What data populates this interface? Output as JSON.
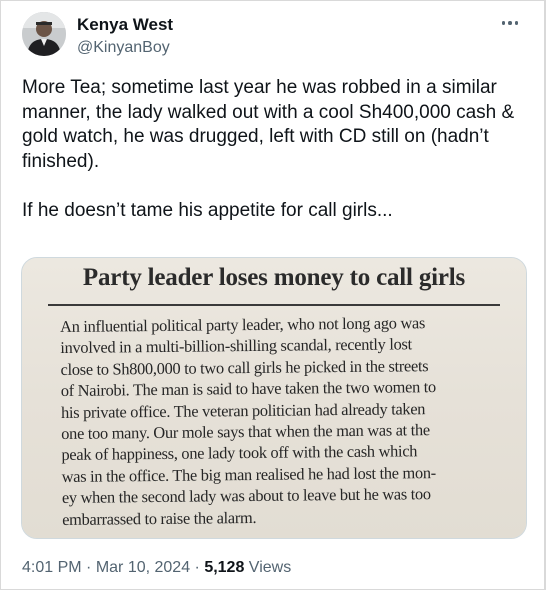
{
  "author": {
    "name": "Kenya West",
    "handle": "@KinyanBoy"
  },
  "tweet": {
    "text": "More Tea; sometime last year he was robbed in a similar manner, the lady walked out with a cool Sh400,000 cash & gold watch, he was drugged, left with CD still on (hadn’t finished).\n\nIf he doesn’t tame his appetite for call girls..."
  },
  "clipping": {
    "headline": "Party leader loses money to call girls",
    "lines": [
      "An influential political party leader, who not long ago was",
      "involved in a multi-billion-shilling scandal, recently lost",
      "close to Sh800,000 to two call girls he picked in the streets",
      "of Nairobi. The man is said to have taken the two women to",
      "his private office. The veteran politician had already taken",
      "one too many. Our mole says that when the man  was at the",
      "peak of happiness, one lady took off with the cash which",
      "was in the office. The big man realised he had lost the mon-",
      "ey when the second lady was about to leave but he was too",
      "embarrassed to raise the alarm."
    ]
  },
  "meta": {
    "time": "4:01 PM",
    "sep1": " · ",
    "date": "Mar 10, 2024",
    "sep2": " · ",
    "views_count": "5,128",
    "views_label": " Views"
  },
  "icons": {
    "more": "more-horizontal-icon",
    "avatar": "profile-photo"
  }
}
